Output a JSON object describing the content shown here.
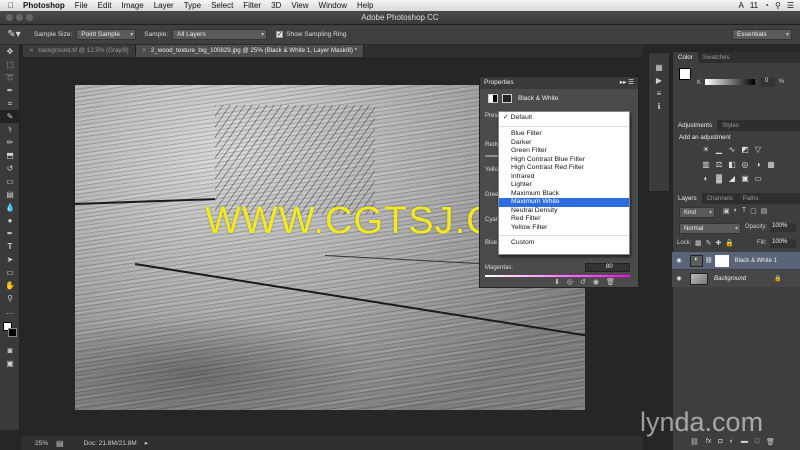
{
  "menubar": {
    "apple": "",
    "app": "Photoshop",
    "items": [
      "File",
      "Edit",
      "Image",
      "Layer",
      "Type",
      "Select",
      "Filter",
      "3D",
      "View",
      "Window",
      "Help"
    ],
    "right": [
      "A",
      "11"
    ]
  },
  "window": {
    "title": "Adobe Photoshop CC"
  },
  "options": {
    "sample_size_label": "Sample Size:",
    "sample_size_value": "Point Sample",
    "sample_label": "Sample:",
    "sample_value": "All Layers",
    "ring_label": "Show Sampling Ring",
    "workspace": "Essentials"
  },
  "tabs": [
    {
      "label": "background.tif @ 12.5% (Gray/8)"
    },
    {
      "label": "2_wood_texture_big_100829.jpg @ 25% (Black & White 1, Layer Mask/8) *"
    }
  ],
  "status": {
    "zoom": "25%",
    "doc": "Doc: 21.8M/21.8M"
  },
  "watermark": "WWW.CGTSJ.COM",
  "properties": {
    "title": "Properties",
    "adj_name": "Black & White",
    "preset_label": "Prese",
    "reds": "Reds",
    "yellows": "Yello",
    "greens": "Green",
    "cyans": "Cyan",
    "blues": "Blue",
    "magentas": "Magentas:",
    "magentas_value": "80"
  },
  "preset_menu": {
    "checked": "Default",
    "items": [
      "Blue Filter",
      "Darker",
      "Green Filter",
      "High Contrast Blue Filter",
      "High Contrast Red Filter",
      "Infrared",
      "Lighter",
      "Maximum Black",
      "Maximum White",
      "Neutral Density",
      "Red Filter",
      "Yellow Filter"
    ],
    "custom": "Custom",
    "selected_index": 8
  },
  "color_panel": {
    "tabs": [
      "Color",
      "Swatches"
    ],
    "k_label": "K",
    "k_value": "0",
    "pct": "%"
  },
  "adjustments": {
    "tabs": [
      "Adjustments",
      "Styles"
    ],
    "label": "Add an adjustment"
  },
  "layers_panel": {
    "tabs": [
      "Layers",
      "Channels",
      "Paths"
    ],
    "kind": "Kind",
    "blend": "Normal",
    "opacity_label": "Opacity:",
    "opacity": "100%",
    "lock_label": "Lock:",
    "fill_label": "Fill:",
    "fill": "100%",
    "layers": [
      {
        "name": "Black & White 1"
      },
      {
        "name": "Background"
      }
    ]
  },
  "lynda": "lynda.com"
}
